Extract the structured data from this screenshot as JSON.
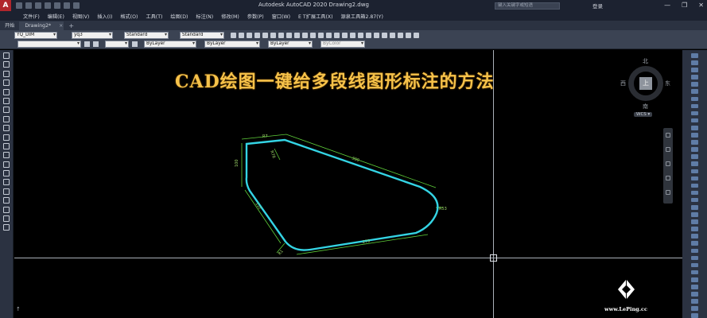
{
  "window": {
    "title": "Autodesk AutoCAD 2020    Drawing2.dwg",
    "search_placeholder": "键入关键字或短语",
    "user": "登录",
    "controls": [
      "—",
      "❐",
      "✕"
    ]
  },
  "menu": [
    "文件(F)",
    "编辑(E)",
    "视图(V)",
    "插入(I)",
    "格式(O)",
    "工具(T)",
    "绘图(D)",
    "标注(N)",
    "修改(M)",
    "参数(P)",
    "窗口(W)",
    "E T扩展工具(X)",
    "源泉工具箱2.87(Y)"
  ],
  "tabs": {
    "start": "开始",
    "drawing": "Drawing2*",
    "close": "×",
    "plus": "+"
  },
  "toolbar1": {
    "dimstyle": "YQ_DIM",
    "layerstyle": "yq3",
    "textstyle": "Standard",
    "tablestyle": "Standard"
  },
  "toolbar2": {
    "layer": "",
    "linetype1": "ByLayer",
    "linetype2": "ByLayer",
    "lineweight": "ByLayer",
    "color": "ByColor"
  },
  "drawing": {
    "heading": "CAD绘图一键给多段线图形标注的方法",
    "dimensions": [
      "R7",
      "R78",
      "100",
      "R53",
      "300",
      "122",
      "279",
      "R1"
    ],
    "shape_color": "#34d4e4",
    "dim_color": "#5fcf3a"
  },
  "viewcube": {
    "north": "北",
    "south": "南",
    "east": "东",
    "west": "西",
    "top": "上",
    "wcs": "WCS ▾"
  },
  "watermark": {
    "text": "www.LePing.cc"
  }
}
